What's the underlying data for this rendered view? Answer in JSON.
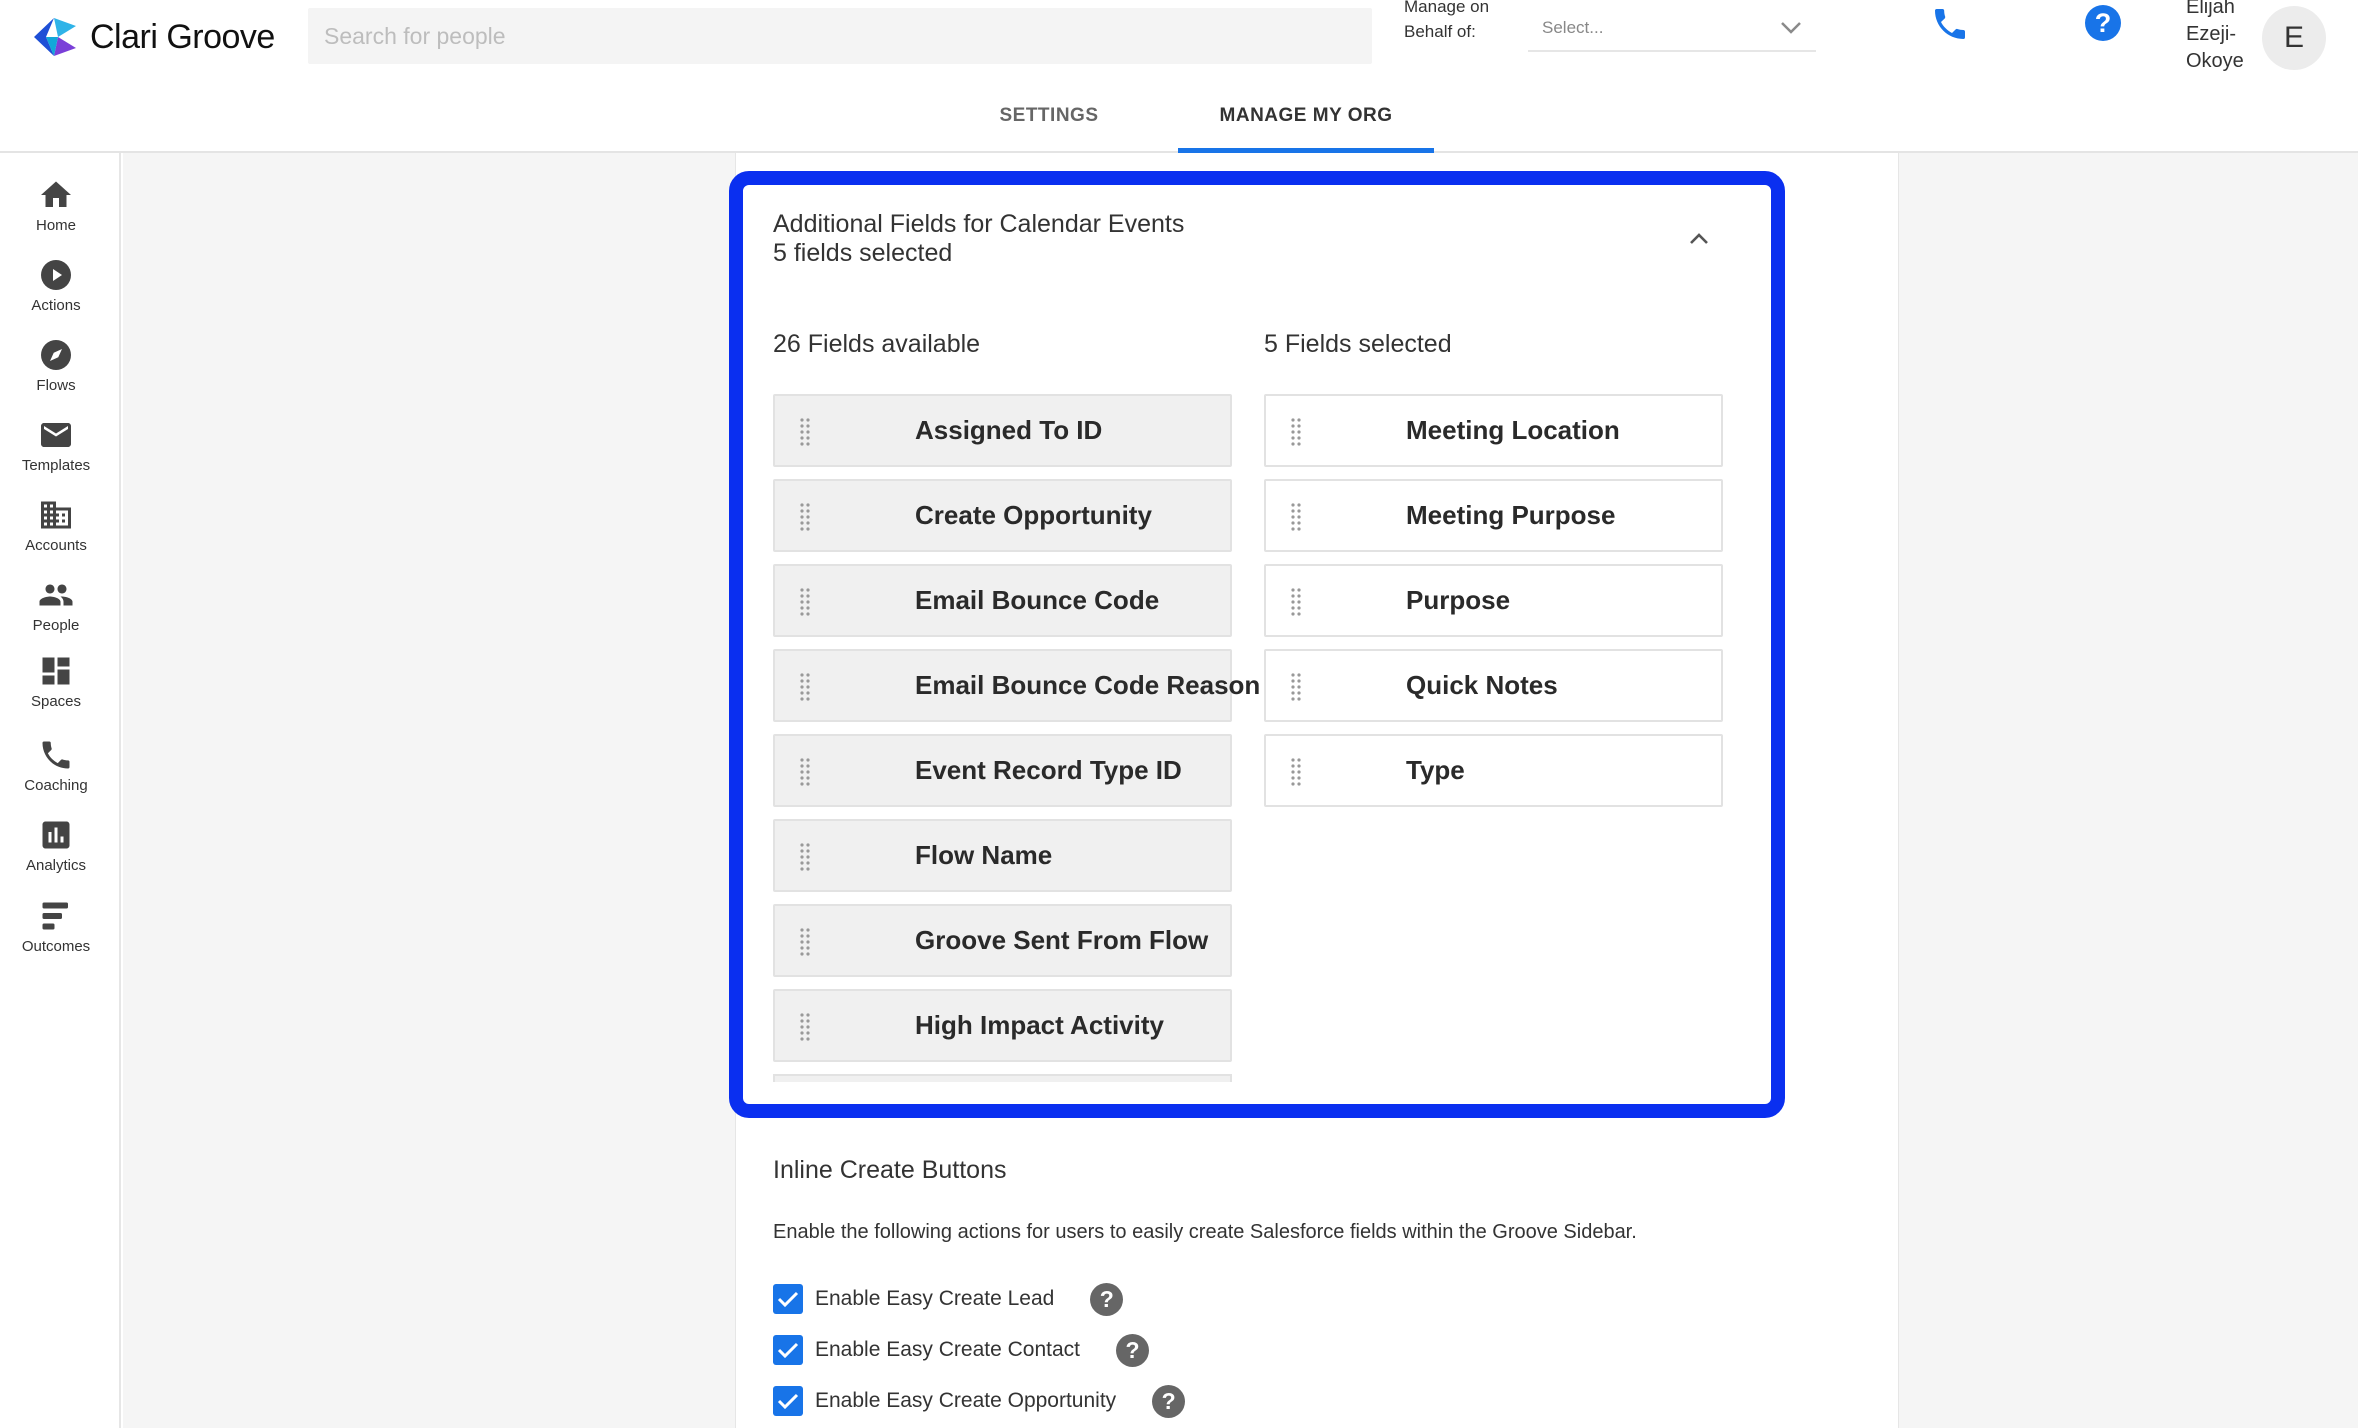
{
  "header": {
    "logo_text": "Clari Groove",
    "search_placeholder": "Search for people",
    "behalf_label": "Manage on Behalf of:",
    "behalf_select": "Select...",
    "user_name": "Elijah Ezeji-Okoye",
    "avatar_initial": "E",
    "help_glyph": "?",
    "accent_color": "#1874e8"
  },
  "tabs": [
    {
      "label": "SETTINGS",
      "active": false
    },
    {
      "label": "MANAGE MY ORG",
      "active": true
    }
  ],
  "sidebar": {
    "items": [
      {
        "label": "Home",
        "icon": "home-icon"
      },
      {
        "label": "Actions",
        "icon": "play-circle-icon"
      },
      {
        "label": "Flows",
        "icon": "compass-icon"
      },
      {
        "label": "Templates",
        "icon": "envelope-icon"
      },
      {
        "label": "Accounts",
        "icon": "building-icon"
      },
      {
        "label": "People",
        "icon": "people-icon"
      },
      {
        "label": "Spaces",
        "icon": "dashboard-icon"
      },
      {
        "label": "Coaching",
        "icon": "phone-icon"
      },
      {
        "label": "Analytics",
        "icon": "bar-chart-icon"
      },
      {
        "label": "Outcomes",
        "icon": "list-icon"
      }
    ]
  },
  "panel": {
    "title": "Additional Fields for Calendar Events",
    "subtitle": "5 fields selected",
    "available_heading": "26 Fields available",
    "selected_heading": "5 Fields selected",
    "highlight_color": "#0a2ff0",
    "available_fields": [
      "Assigned To ID",
      "Create Opportunity",
      "Email Bounce Code",
      "Email Bounce Code Reason",
      "Event Record Type ID",
      "Flow Name",
      "Groove Sent From Flow",
      "High Impact Activity"
    ],
    "selected_fields": [
      "Meeting Location",
      "Meeting Purpose",
      "Purpose",
      "Quick Notes",
      "Type"
    ]
  },
  "inline_create": {
    "title": "Inline Create Buttons",
    "description": "Enable the following actions for users to easily create Salesforce fields within the Groove Sidebar.",
    "options": [
      {
        "label": "Enable Easy Create Lead",
        "checked": true
      },
      {
        "label": "Enable Easy Create Contact",
        "checked": true
      },
      {
        "label": "Enable Easy Create Opportunity",
        "checked": true
      }
    ],
    "help_glyph": "?"
  }
}
